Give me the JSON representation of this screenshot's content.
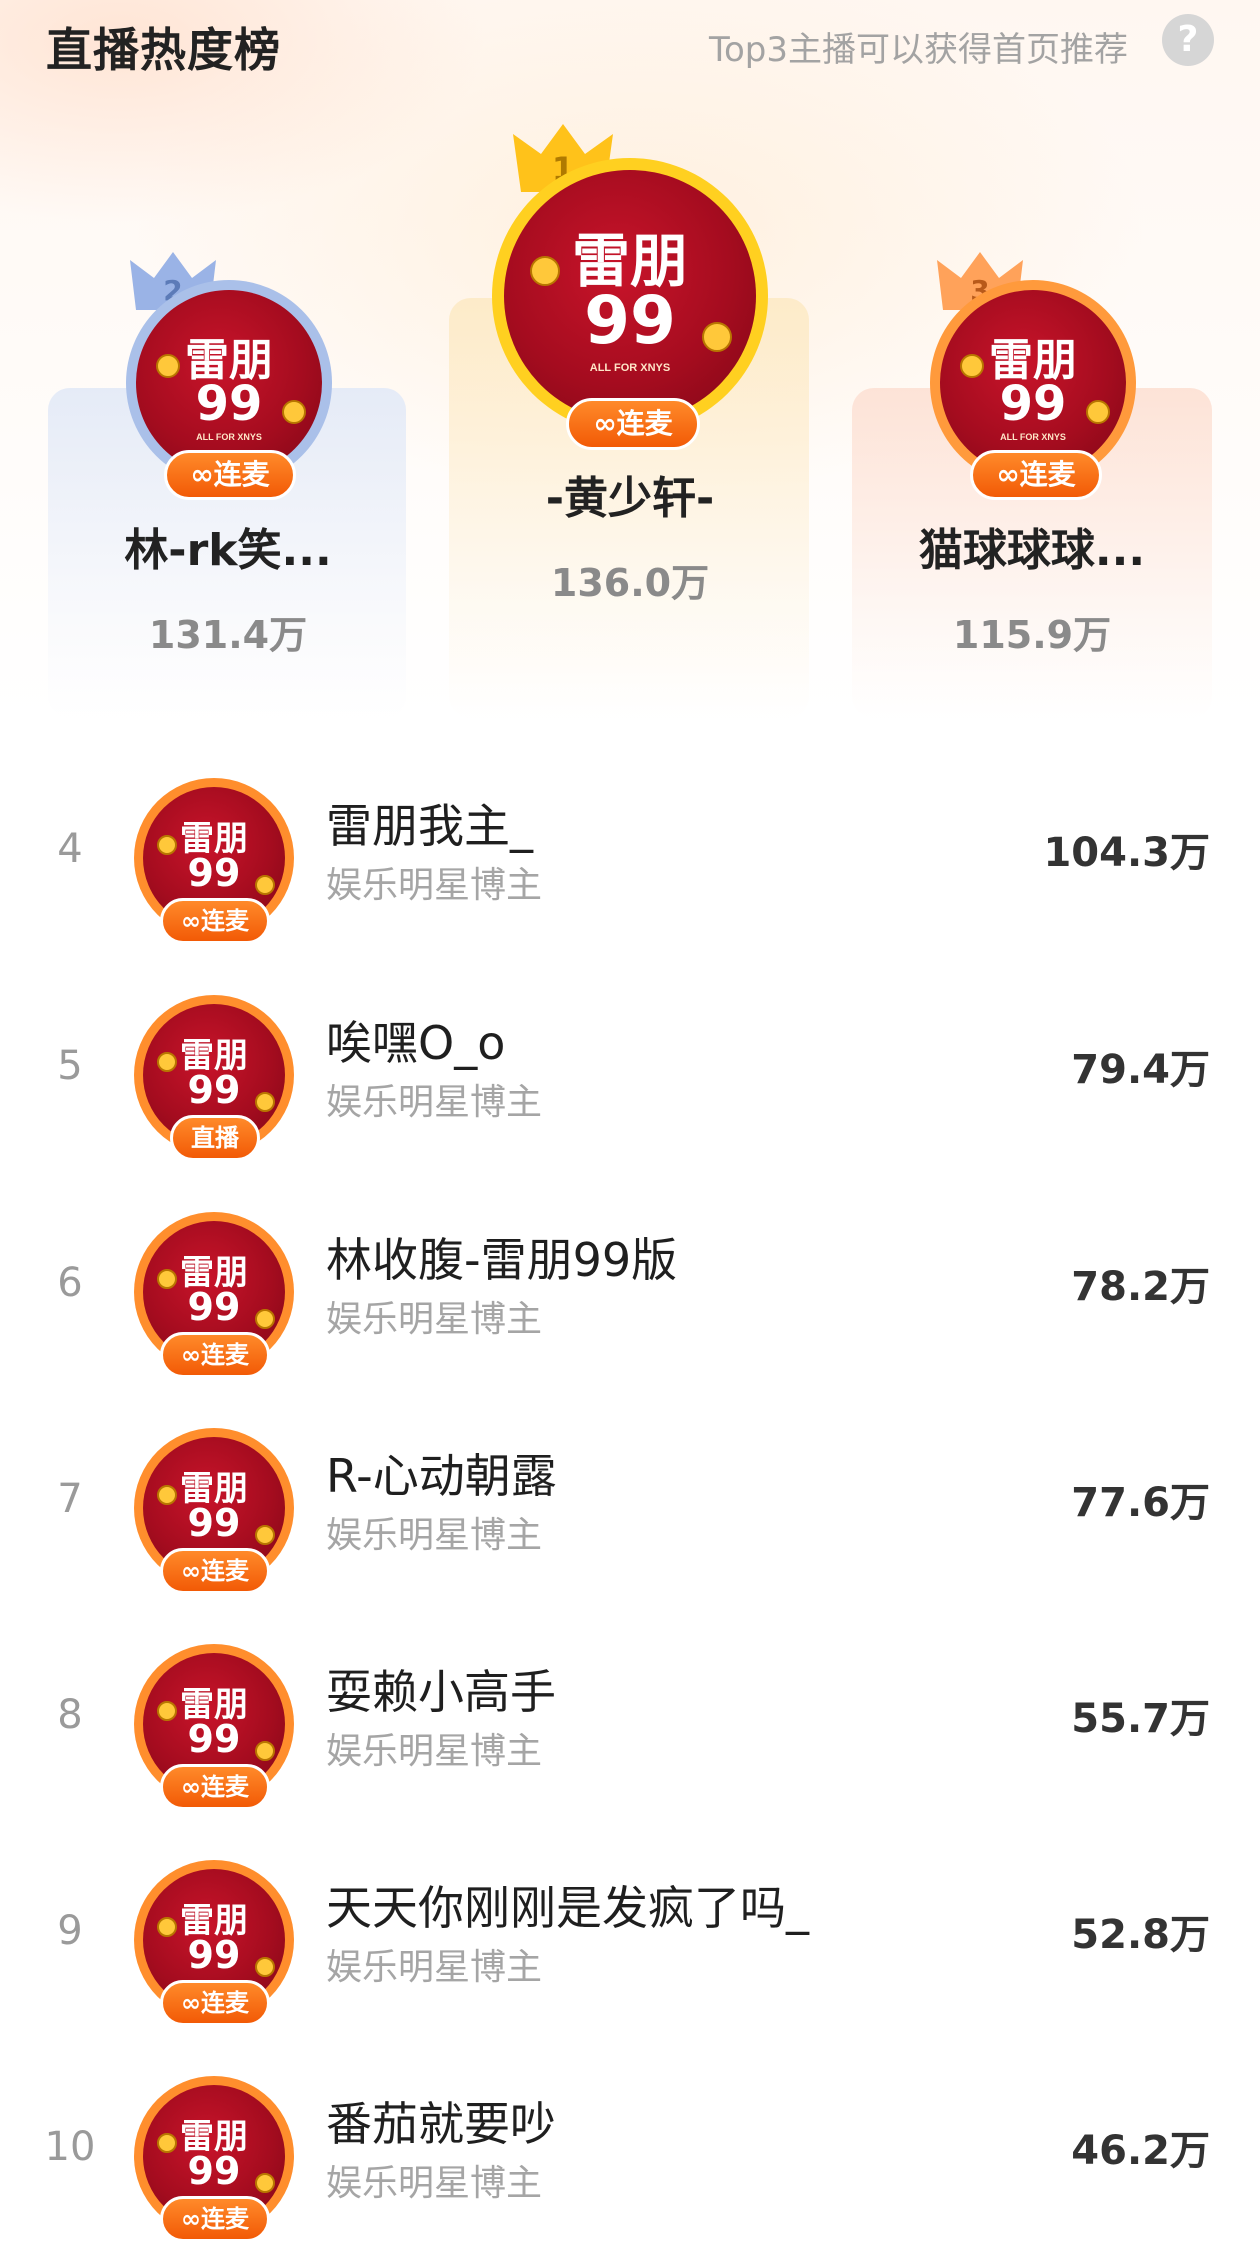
{
  "header": {
    "title": "直播热度榜",
    "subtitle": "Top3主播可以获得首页推荐",
    "help_glyph": "?"
  },
  "avatar": {
    "line1": "雷朋",
    "line2": "99",
    "tag": "ALL FOR XNYS"
  },
  "podium": [
    {
      "rank": "1",
      "name": "-黄少轩-",
      "score": "136.0万",
      "badge": "连麦",
      "crown_color": "#ffc21a"
    },
    {
      "rank": "2",
      "name": "林-rk笑...",
      "score": "131.4万",
      "badge": "连麦",
      "crown_color": "#9ab3e6"
    },
    {
      "rank": "3",
      "name": "猫球球球...",
      "score": "115.9万",
      "badge": "连麦",
      "crown_color": "#ffa25a"
    }
  ],
  "list": [
    {
      "rank": "4",
      "name": "雷朋我主_",
      "category": "娱乐明星博主",
      "score": "104.3万",
      "badge": "连麦"
    },
    {
      "rank": "5",
      "name": "唉嘿O_o",
      "category": "娱乐明星博主",
      "score": "79.4万",
      "badge": "直播"
    },
    {
      "rank": "6",
      "name": "林收腹-雷朋99版",
      "category": "娱乐明星博主",
      "score": "78.2万",
      "badge": "连麦"
    },
    {
      "rank": "7",
      "name": "R-心动朝露",
      "category": "娱乐明星博主",
      "score": "77.6万",
      "badge": "连麦"
    },
    {
      "rank": "8",
      "name": "耍赖小高手",
      "category": "娱乐明星博主",
      "score": "55.7万",
      "badge": "连麦"
    },
    {
      "rank": "9",
      "name": "天天你刚刚是发疯了吗_",
      "category": "娱乐明星博主",
      "score": "52.8万",
      "badge": "连麦"
    },
    {
      "rank": "10",
      "name": "番茄就要吵",
      "category": "娱乐明星博主",
      "score": "46.2万",
      "badge": "连麦"
    }
  ],
  "colors": {
    "accent_orange": "#f56a10",
    "avatar_red": "#b1101f",
    "gold": "#ffc21a",
    "silver": "#9ab3e6",
    "bronze": "#ffa25a"
  }
}
